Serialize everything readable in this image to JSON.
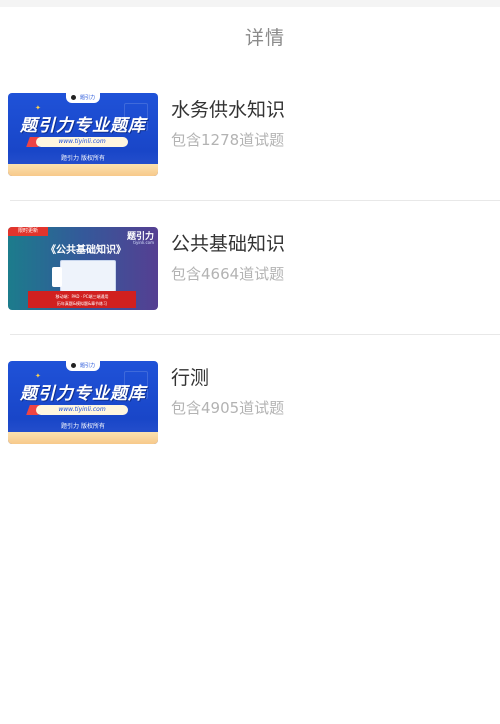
{
  "header": {
    "title": "详情"
  },
  "items": [
    {
      "title": "水务供水知识",
      "subtitle": "包含1278道试题",
      "thumb": {
        "style": "blue",
        "logo_text": "题引力",
        "main_text": "题引力专业题库",
        "url_text": "www.tiyinli.com",
        "small_text": "题引力 版权所有"
      }
    },
    {
      "title": "公共基础知识",
      "subtitle": "包含4664道试题",
      "thumb": {
        "style": "dark",
        "tag_text": "限时更新",
        "brand_text": "题引力",
        "brand_url": "tiyinli.com",
        "main_text": "《公共基础知识》",
        "red_line_1": "移动端：PAD · PC端三端通用",
        "red_line_2": "历年真题&模拟题&章节练习"
      }
    },
    {
      "title": "行测",
      "subtitle": "包含4905道试题",
      "thumb": {
        "style": "blue",
        "logo_text": "题引力",
        "main_text": "题引力专业题库",
        "url_text": "www.tiyinli.com",
        "small_text": "题引力 版权所有"
      }
    }
  ]
}
